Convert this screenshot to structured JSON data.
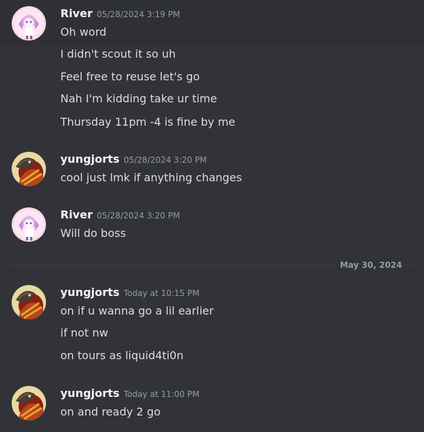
{
  "messages": [
    {
      "username": "River",
      "timestamp": "05/28/2024 3:19 PM",
      "lines": [
        "Oh word",
        "I didn't scout it so uh",
        "Feel free to reuse let's go",
        "Nah I'm kidding take ur time",
        "Thursday 11pm -4 is fine by me"
      ]
    },
    {
      "username": "yungjorts",
      "timestamp": "05/28/2024 3:20 PM",
      "lines": [
        "cool just lmk if anything changes"
      ]
    },
    {
      "username": "River",
      "timestamp": "05/28/2024 3:20 PM",
      "lines": [
        "Will do boss"
      ]
    },
    {
      "username": "yungjorts",
      "timestamp": "Today at 10:15 PM",
      "lines": [
        "on if u wanna go a lil earlier",
        "if not nw",
        "on tours as liquid4ti0n"
      ]
    },
    {
      "username": "yungjorts",
      "timestamp": "Today at 11:00 PM",
      "lines": [
        "on and ready 2 go"
      ]
    }
  ],
  "date_divider": {
    "label": "May 30, 2024"
  },
  "colors": {
    "background": "#313338",
    "text": "#dbdee1",
    "username": "#f2f3f5",
    "timestamp": "#949ba4"
  }
}
